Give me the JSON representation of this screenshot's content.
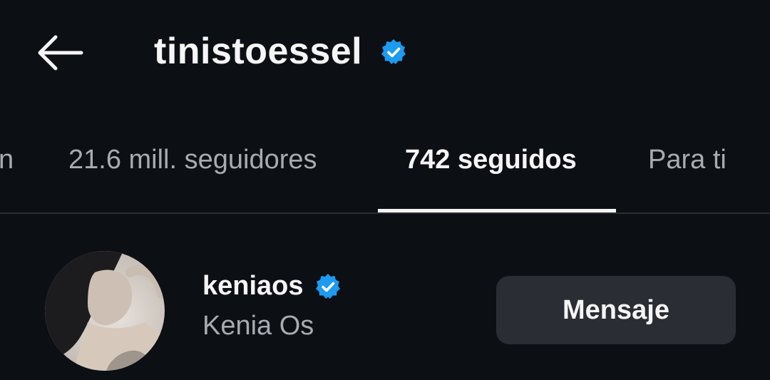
{
  "header": {
    "title": "tinistoessel",
    "back_icon": "arrow-left-icon",
    "verified_icon": "verified-badge-icon"
  },
  "tabs": [
    {
      "label": "n"
    },
    {
      "label": "21.6 mill. seguidores"
    },
    {
      "label": "742 seguidos",
      "active": true
    },
    {
      "label": "Para ti"
    }
  ],
  "list": {
    "items": [
      {
        "username": "keniaos",
        "full_name": "Kenia Os",
        "verified_icon": "verified-badge-icon",
        "button_label": "Mensaje"
      }
    ]
  },
  "colors": {
    "background": "#0c0f14",
    "verified": "#1d9bf0",
    "button": "#2a2d33",
    "muted_text": "#a8abb2"
  }
}
